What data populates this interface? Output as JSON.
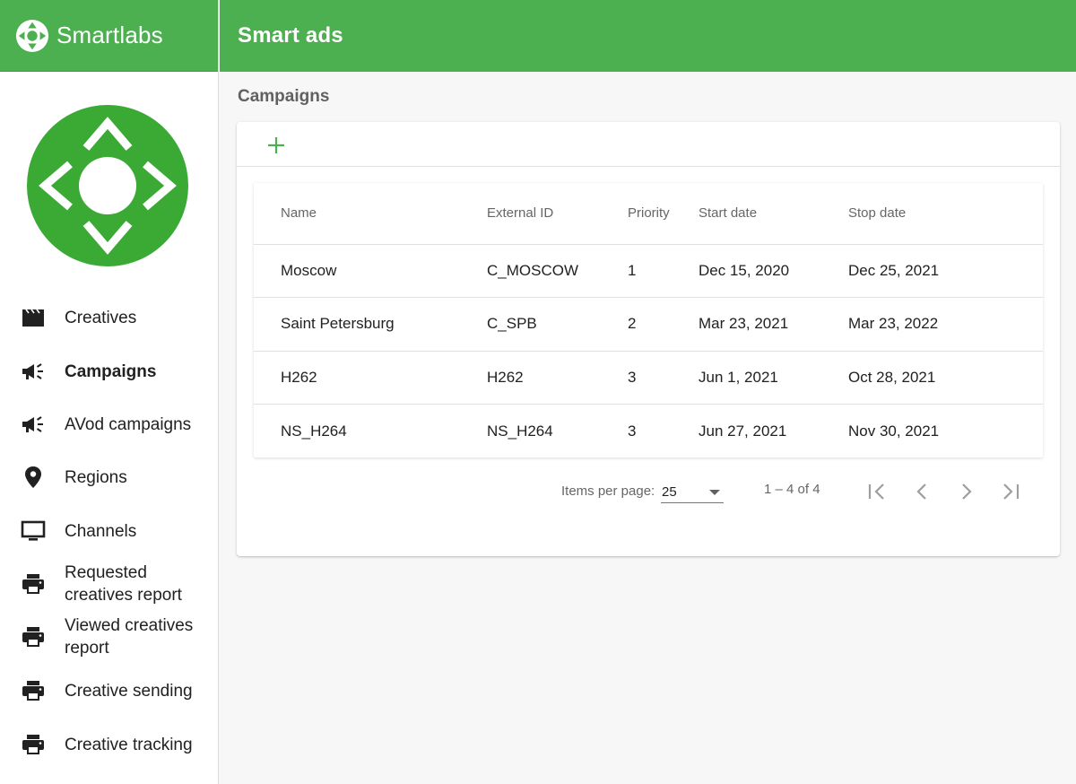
{
  "brand": {
    "name": "Smartlabs",
    "logo_icon": "compass-logo-icon",
    "color": "#4caf50"
  },
  "header": {
    "title": "Smart ads"
  },
  "sidebar": {
    "items": [
      {
        "label": "Creatives",
        "icon": "clapperboard-icon",
        "active": false
      },
      {
        "label": "Campaigns",
        "icon": "megaphone-icon",
        "active": true
      },
      {
        "label": "AVod campaigns",
        "icon": "megaphone-icon",
        "active": false
      },
      {
        "label": "Regions",
        "icon": "map-pin-icon",
        "active": false
      },
      {
        "label": "Channels",
        "icon": "monitor-icon",
        "active": false
      },
      {
        "label": "Requested\ncreatives report",
        "icon": "printer-icon",
        "active": false
      },
      {
        "label": "Viewed creatives\nreport",
        "icon": "printer-icon",
        "active": false
      },
      {
        "label": "Creative sending",
        "icon": "printer-icon",
        "active": false
      },
      {
        "label": "Creative tracking",
        "icon": "printer-icon",
        "active": false
      }
    ]
  },
  "main": {
    "page_title": "Campaigns",
    "add_icon": "plus-icon",
    "table": {
      "columns": [
        "Name",
        "External ID",
        "Priority",
        "Start date",
        "Stop date"
      ],
      "rows": [
        [
          "Moscow",
          "C_MOSCOW",
          "1",
          "Dec 15, 2020",
          "Dec 25, 2021"
        ],
        [
          "Saint Petersburg",
          "C_SPB",
          "2",
          "Mar 23, 2021",
          "Mar 23, 2022"
        ],
        [
          "H262",
          "H262",
          "3",
          "Jun 1, 2021",
          "Oct 28, 2021"
        ],
        [
          "NS_H264",
          "NS_H264",
          "3",
          "Jun 27, 2021",
          "Nov 30, 2021"
        ]
      ]
    },
    "paginator": {
      "items_per_page_label": "Items per page:",
      "items_per_page_value": "25",
      "range_label": "1 – 4 of 4",
      "buttons": [
        "first-page-icon",
        "previous-page-icon",
        "next-page-icon",
        "last-page-icon"
      ]
    }
  }
}
